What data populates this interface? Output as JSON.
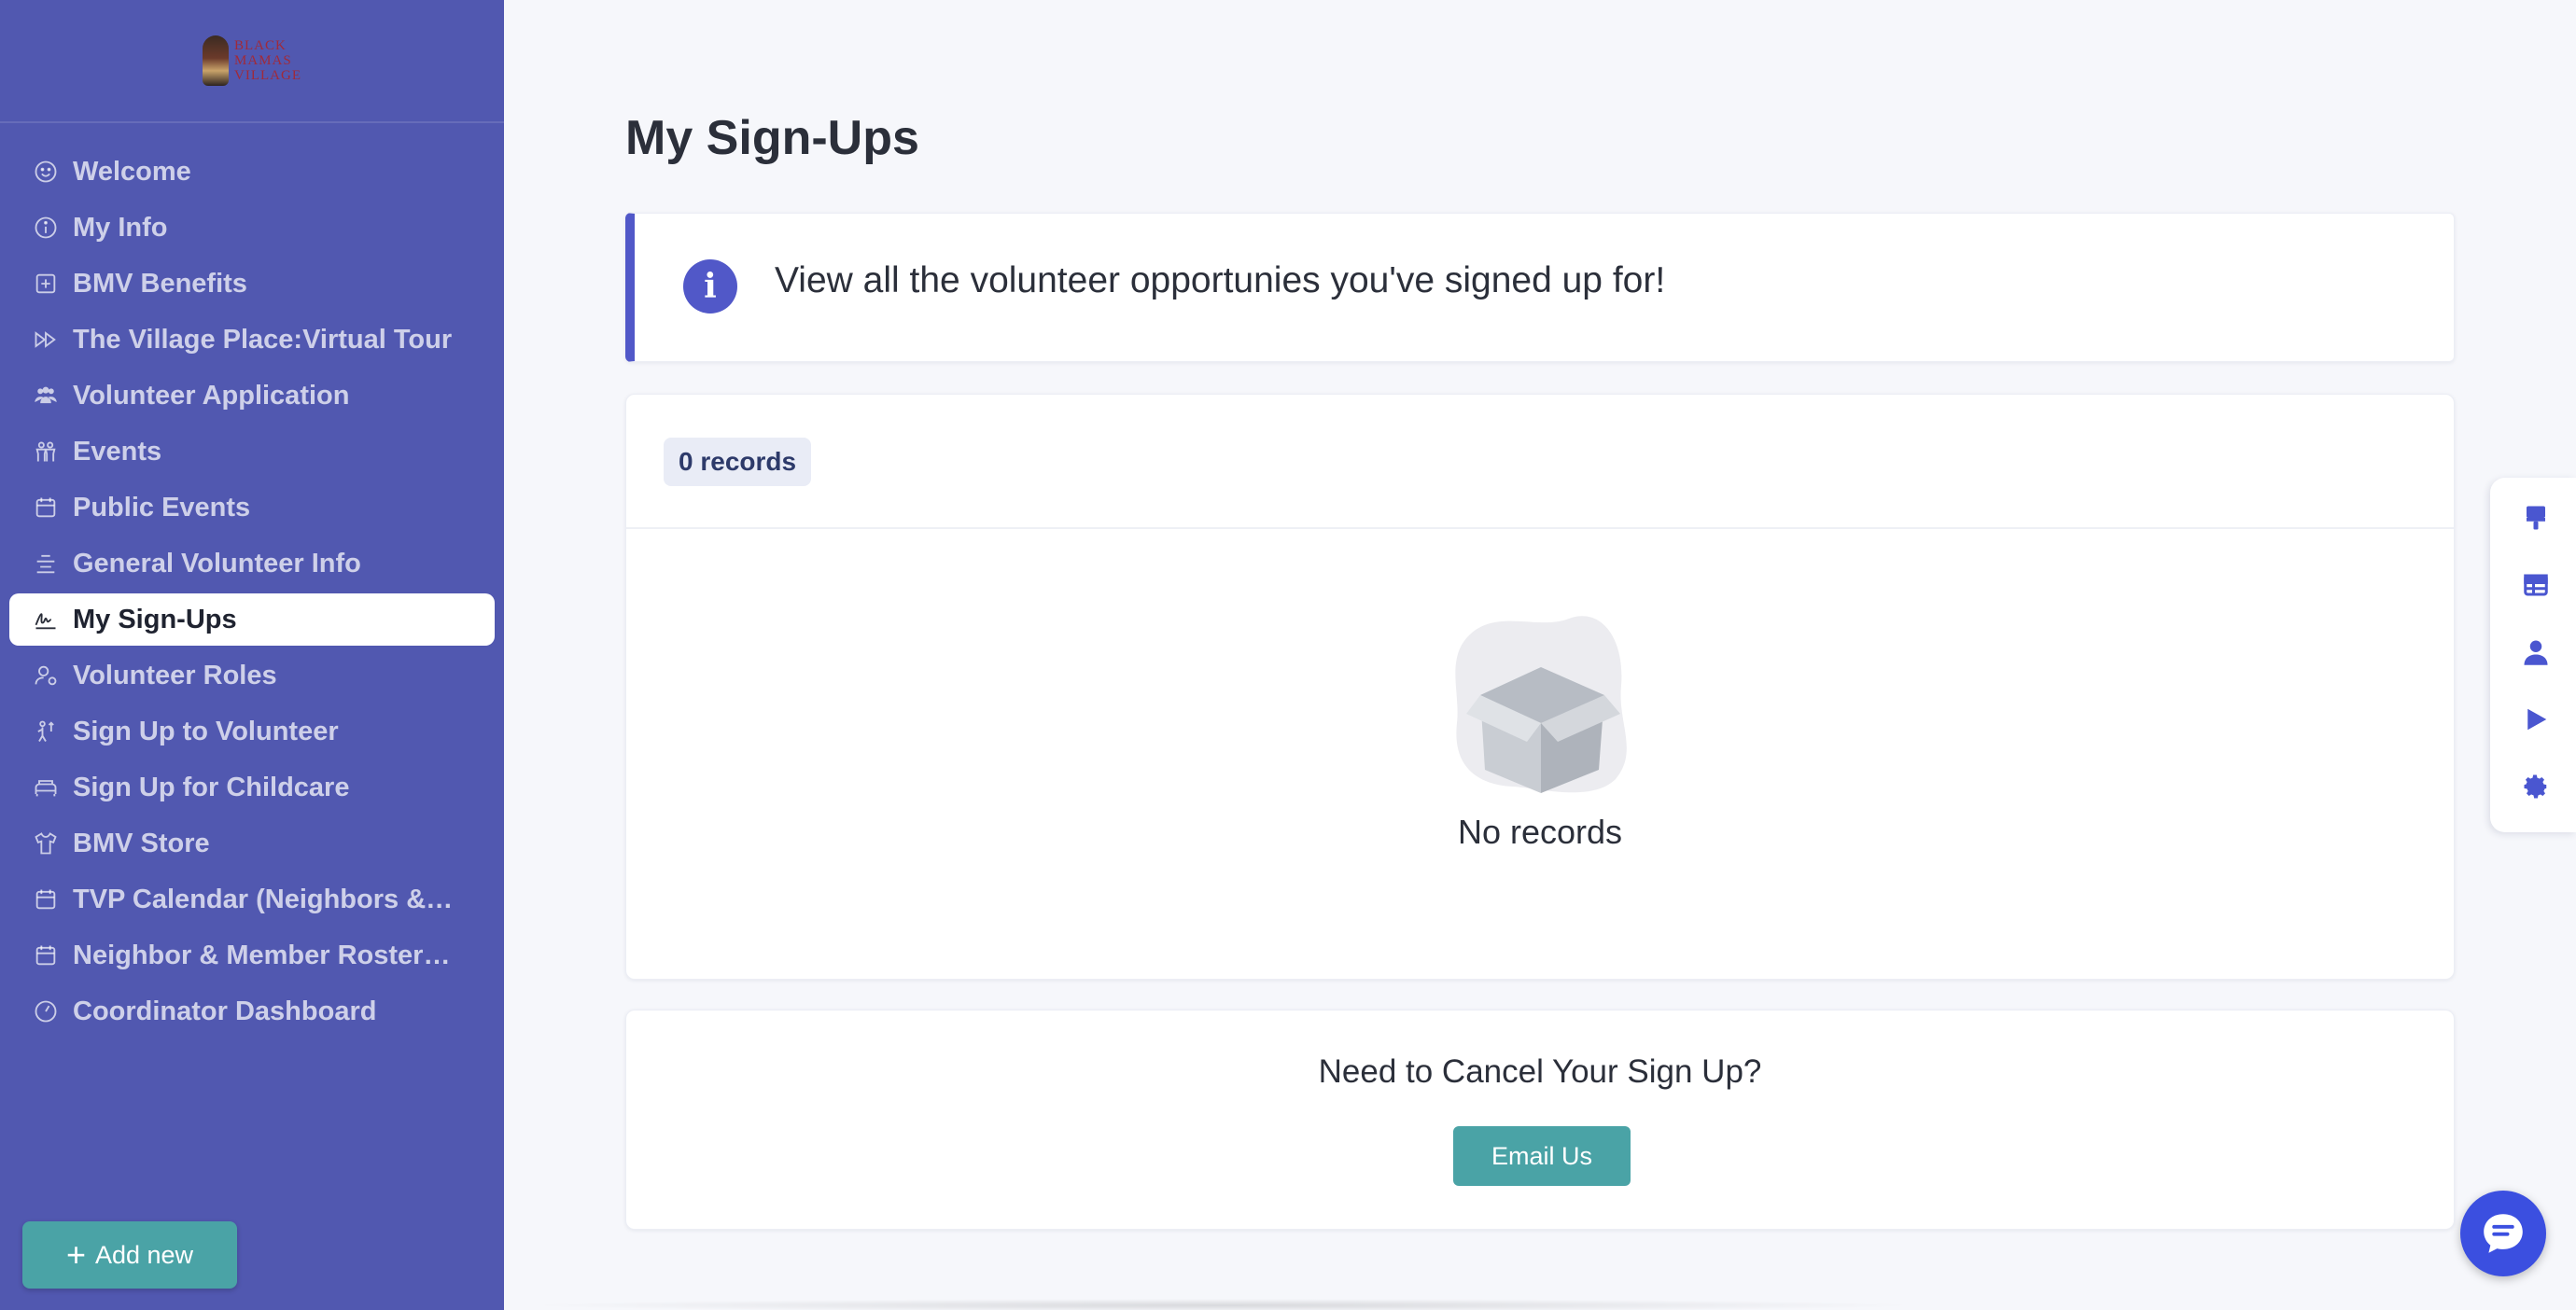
{
  "sidebar": {
    "logo_text": [
      "BLACK",
      "MAMAS",
      "VILLAGE"
    ],
    "items": [
      {
        "label": "Welcome",
        "icon": "smile-icon"
      },
      {
        "label": "My Info",
        "icon": "info-circle-icon"
      },
      {
        "label": "BMV Benefits",
        "icon": "plus-square-icon"
      },
      {
        "label": "The Village Place:Virtual Tour",
        "icon": "fast-forward-icon"
      },
      {
        "label": "Volunteer Application",
        "icon": "users-icon"
      },
      {
        "label": "Events",
        "icon": "people-icon"
      },
      {
        "label": "Public Events",
        "icon": "calendar-icon"
      },
      {
        "label": "General Volunteer Info",
        "icon": "align-center-icon"
      },
      {
        "label": "My Sign-Ups",
        "icon": "signature-icon",
        "active": true
      },
      {
        "label": "Volunteer Roles",
        "icon": "user-cog-icon"
      },
      {
        "label": "Sign Up to Volunteer",
        "icon": "person-hand-icon"
      },
      {
        "label": "Sign Up for Childcare",
        "icon": "bed-icon"
      },
      {
        "label": "BMV Store",
        "icon": "shirt-icon"
      },
      {
        "label": "TVP Calendar (Neighbors &…",
        "icon": "calendar-icon"
      },
      {
        "label": "Neighbor & Member Roster…",
        "icon": "calendar-icon"
      },
      {
        "label": "Coordinator Dashboard",
        "icon": "gauge-icon"
      }
    ],
    "add_new_label": "Add new"
  },
  "main": {
    "title": "My Sign-Ups",
    "info_message": "View all the volunteer opportunies you've signed up for!",
    "records_badge": "0 records",
    "empty_text": "No records",
    "cancel_title": "Need to Cancel Your Sign Up?",
    "email_button": "Email Us"
  },
  "colors": {
    "sidebar_bg": "#5158b0",
    "accent": "#5158c8",
    "button_teal": "#4aa3a6",
    "chat_blue": "#3b4fe0"
  },
  "right_rail": [
    "brush-icon",
    "table-icon",
    "user-icon",
    "play-icon",
    "gear-icon"
  ]
}
